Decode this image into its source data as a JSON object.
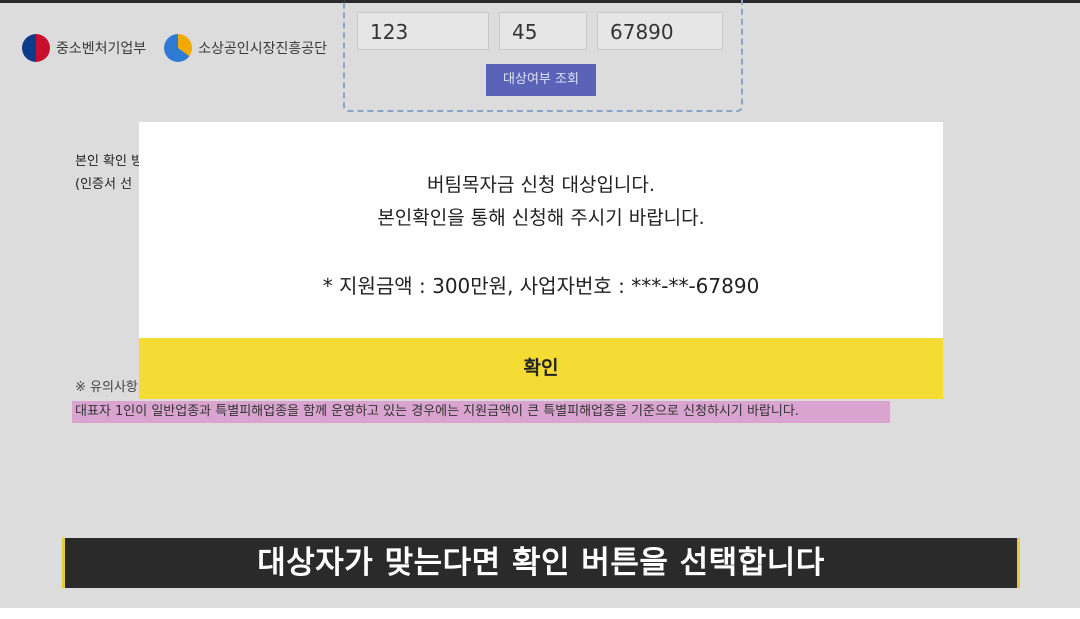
{
  "header": {
    "logo_1": "중소벤처기업부",
    "logo_2": "소상공인시장진흥공단"
  },
  "business_number": {
    "part_1": "123",
    "part_2": "45",
    "part_3": "67890"
  },
  "query_button_label": "대상여부 조회",
  "background_text": {
    "identity_line_1": "본인 확인 방",
    "identity_line_2": "(인증서 선",
    "notice_label": "※ 유의사항",
    "warning": "대표자 1인이 일반업종과 특별피해업종을 함께 운영하고 있는 경우에는 지원금액이 큰 특별피해업종을 기준으로 신청하시기 바랍니다."
  },
  "dialog": {
    "line_1": "버팀목자금 신청 대상입니다.",
    "line_2": "본인확인을 통해 신청해 주시기 바랍니다.",
    "line_3": "* 지원금액 : 300만원, 사업자번호 : ***-**-67890",
    "confirm_label": "확인"
  },
  "subtitle": "대상자가 맞는다면 확인 버튼을 선택합니다",
  "colors": {
    "confirm_yellow": "#f5dc34",
    "query_button": "#5a63b8",
    "warning_highlight": "#d9a4cf",
    "subtitle_border": "#e8c93a"
  }
}
